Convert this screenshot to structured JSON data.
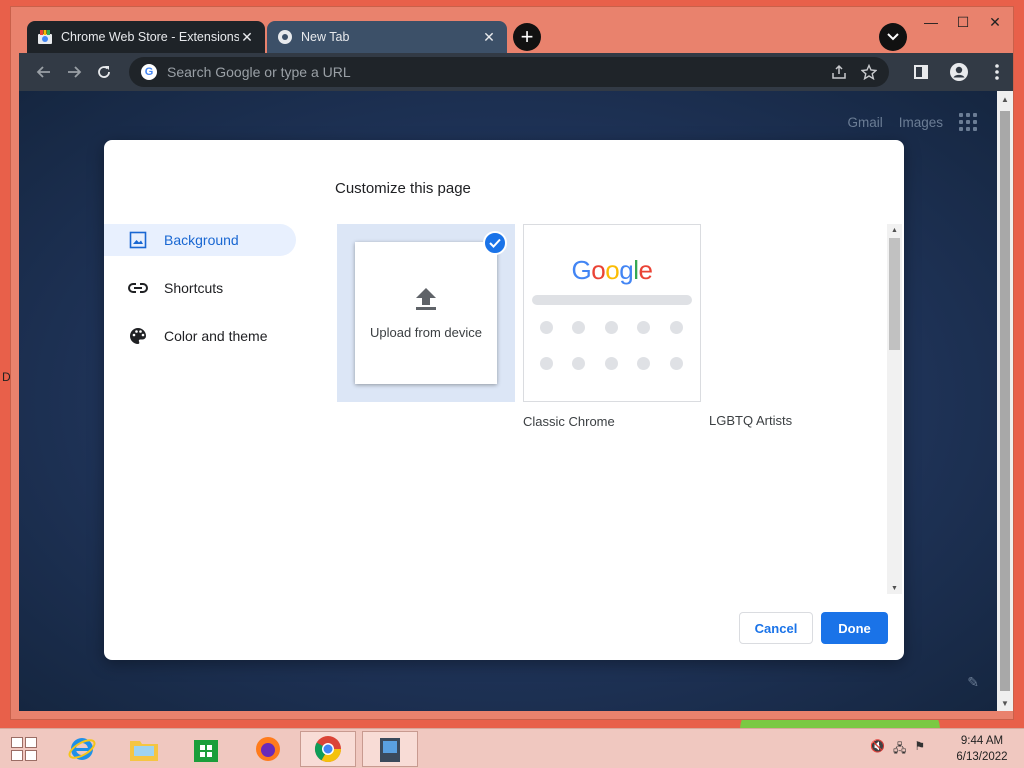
{
  "browser": {
    "tabs": [
      {
        "title": "Chrome Web Store - Extensions",
        "active": true
      },
      {
        "title": "New Tab",
        "active": false
      }
    ],
    "omnibox": {
      "placeholder": "Search Google or type a URL"
    }
  },
  "ntp": {
    "links": [
      "Gmail",
      "Images"
    ]
  },
  "dialog": {
    "title": "Customize this page",
    "menu": [
      {
        "label": "Background",
        "selected": true
      },
      {
        "label": "Shortcuts",
        "selected": false
      },
      {
        "label": "Color and theme",
        "selected": false
      }
    ],
    "tiles": [
      {
        "label": "Upload from device",
        "selected": true
      },
      {
        "label": "Classic Chrome"
      },
      {
        "label": "LGBTQ Artists"
      }
    ],
    "google_logo": "Google",
    "cancel_label": "Cancel",
    "done_label": "Done"
  },
  "desktop": {
    "edge_letter": "D"
  },
  "taskbar": {
    "time": "9:44 AM",
    "date": "6/13/2022"
  },
  "colors": {
    "accent": "#1a73e8",
    "selected_bg": "#e8f0fe"
  }
}
